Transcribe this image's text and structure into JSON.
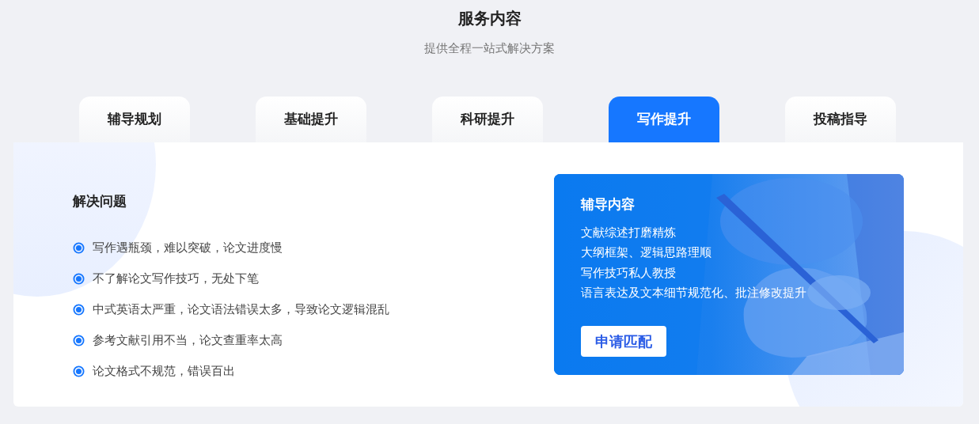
{
  "header": {
    "title": "服务内容",
    "subtitle": "提供全程一站式解决方案"
  },
  "tabs": [
    {
      "label": "辅导规划",
      "selected": false
    },
    {
      "label": "基础提升",
      "selected": false
    },
    {
      "label": "科研提升",
      "selected": false
    },
    {
      "label": "写作提升",
      "selected": true
    },
    {
      "label": "投稿指导",
      "selected": false
    }
  ],
  "problems": {
    "title": "解决问题",
    "items": [
      "写作遇瓶颈，难以突破，论文进度慢",
      "不了解论文写作技巧，无处下笔",
      "中式英语太严重，论文语法错误太多，导致论文逻辑混乱",
      "参考文献引用不当，论文查重率太高",
      "论文格式不规范，错误百出"
    ]
  },
  "service_card": {
    "title": "辅导内容",
    "items": [
      "文献综述打磨精炼",
      "大纲框架、逻辑思路理顺",
      "写作技巧私人教授",
      "语言表达及文本细节规范化、批注修改提升"
    ],
    "button": "申请匹配",
    "background": {
      "kind": "picture"
    }
  }
}
